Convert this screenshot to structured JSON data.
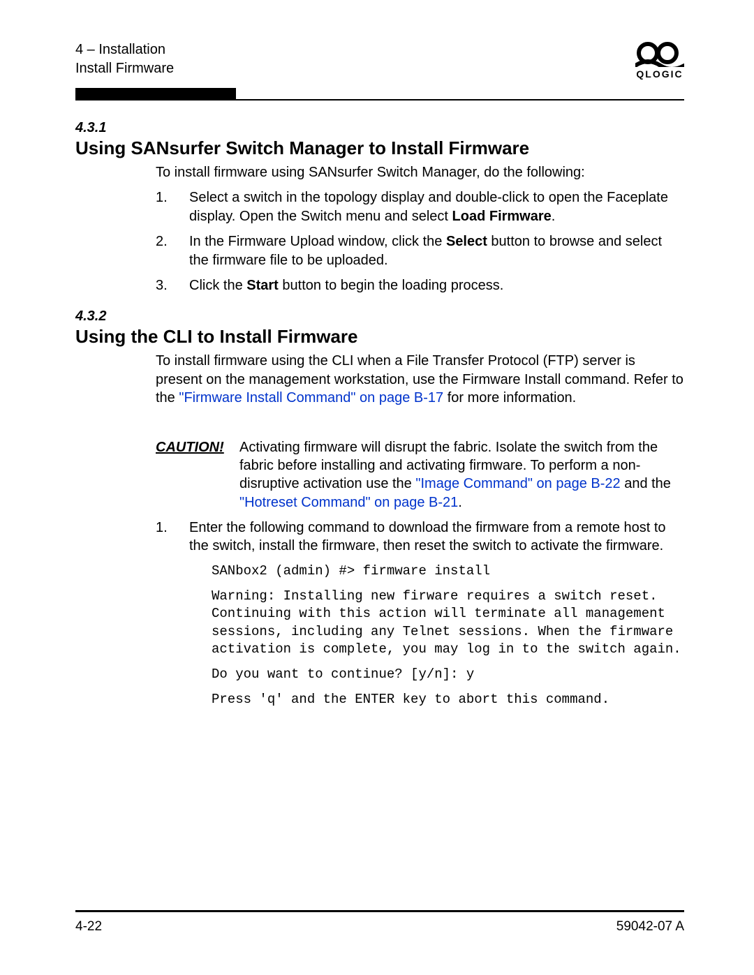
{
  "header": {
    "chapter_line": "4 – Installation",
    "section_line": "Install Firmware",
    "logo_text": "QLOGIC"
  },
  "s431": {
    "num": "4.3.1",
    "title": "Using SANsurfer Switch Manager to Install Firmware",
    "intro": "To install firmware using SANsurfer Switch Manager, do the following:",
    "step1_num": "1.",
    "step1_a": "Select a switch in the topology display and double-click to open the Faceplate display. Open the Switch menu and select ",
    "step1_b": "Load Firmware",
    "step1_c": ".",
    "step2_num": "2.",
    "step2_a": "In the Firmware Upload window, click the ",
    "step2_b": "Select",
    "step2_c": " button to browse and select the firmware file to be uploaded.",
    "step3_num": "3.",
    "step3_a": "Click the ",
    "step3_b": "Start",
    "step3_c": " button to begin the loading process."
  },
  "s432": {
    "num": "4.3.2",
    "title": "Using the CLI to Install Firmware",
    "intro_a": "To install firmware using the CLI when a File Transfer Protocol (FTP) server is present on the management workstation, use the Firmware Install command. Refer to the ",
    "intro_link": "\"Firmware Install Command\" on page B-17",
    "intro_b": " for more information.",
    "caution_label": "CAUTION!",
    "caution_a": "Activating firmware will disrupt the fabric. Isolate the switch from the fabric before installing and activating firmware. To perform a non-disruptive activation use the ",
    "caution_link1": "\"Image Command\" on page B-22",
    "caution_mid": " and the ",
    "caution_link2": "\"Hotreset Command\" on page B-21",
    "caution_end": ".",
    "step1_num": "1.",
    "step1_text": "Enter the following command to download the firmware from a remote host to the switch, install the firmware, then reset the switch to activate the firmware.",
    "code1": "SANbox2 (admin) #> firmware install",
    "code2": "Warning: Installing new firware requires a switch reset. Continuing with this action will terminate all management sessions, including any Telnet sessions. When the firmware activation is complete, you may log in to the switch again.",
    "code3": "Do you want to continue? [y/n]: y",
    "code4": "Press 'q' and the ENTER key to abort this command."
  },
  "footer": {
    "page": "4-22",
    "docid": "59042-07  A"
  }
}
